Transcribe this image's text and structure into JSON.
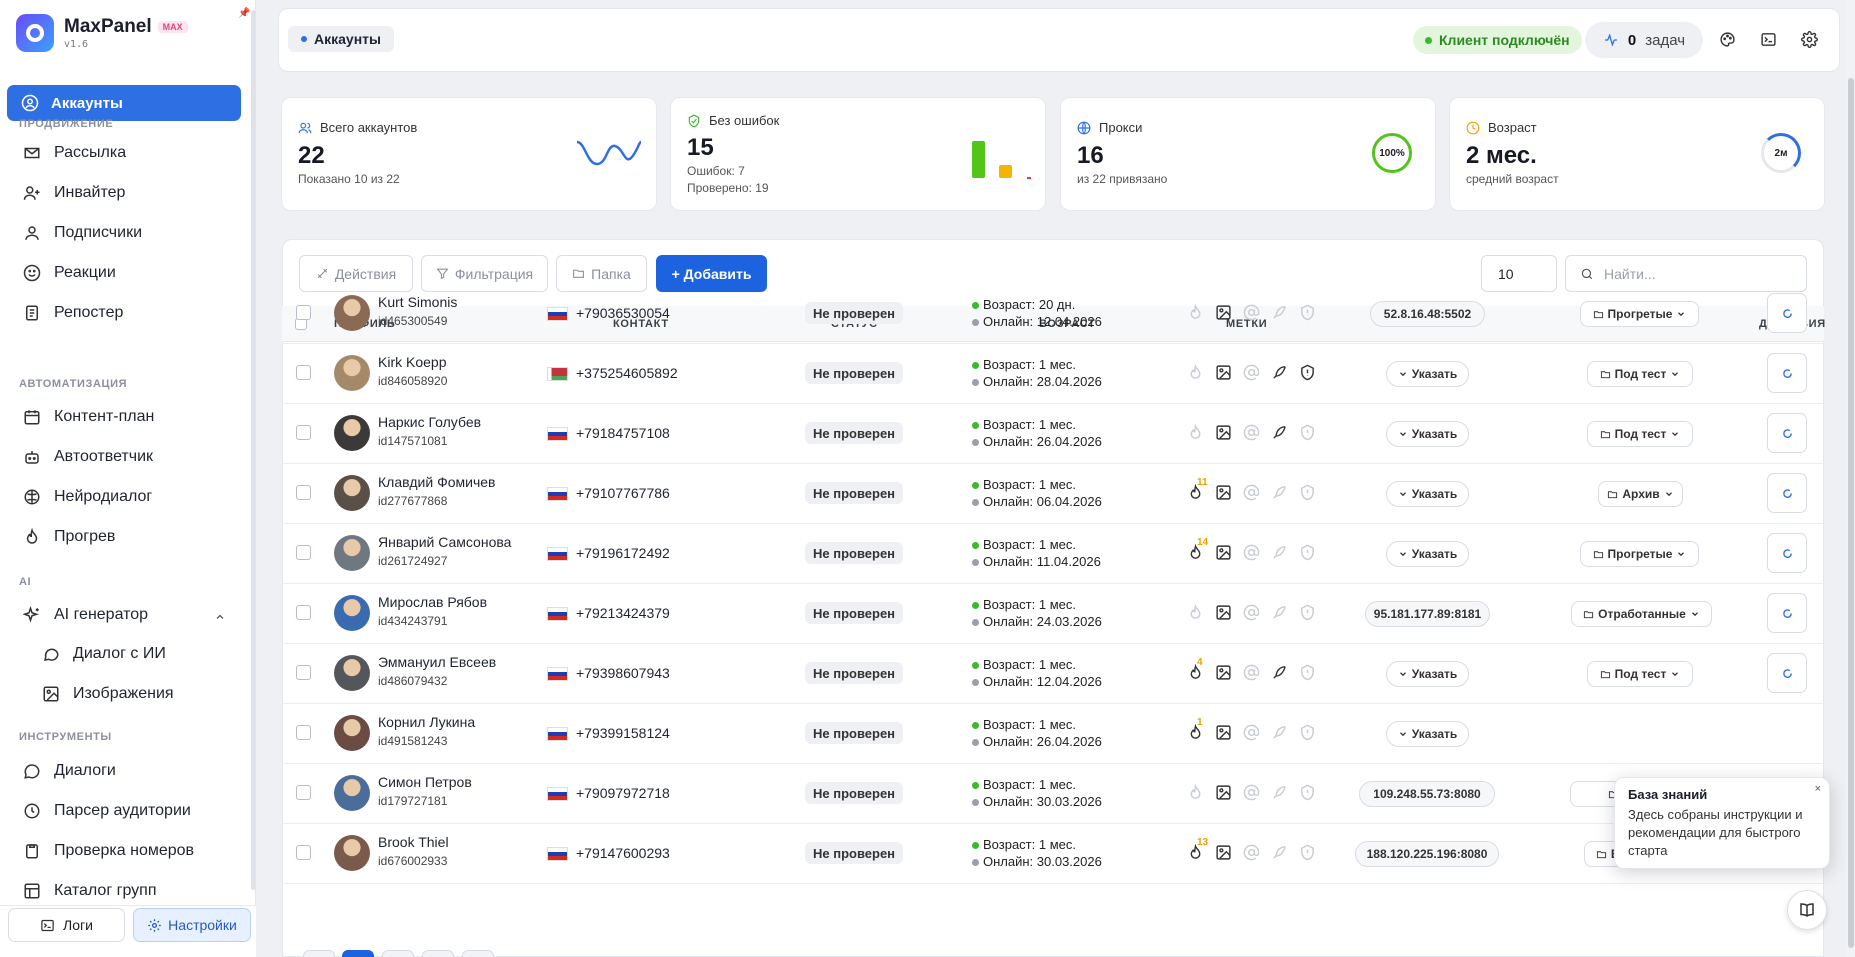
{
  "app": {
    "name": "MaxPanel",
    "badge": "MAX",
    "version": "v1.6"
  },
  "sidebar": {
    "active": "Аккаунты",
    "sections": {
      "promo": "ПРОДВИЖЕНИЕ",
      "auto": "АВТОМАТИЗАЦИЯ",
      "ai": "AI",
      "tools": "ИНСТРУМЕНТЫ"
    },
    "items": {
      "mailing": "Рассылка",
      "inviter": "Инвайтер",
      "subscribers": "Подписчики",
      "reactions": "Реакции",
      "reposter": "Репостер",
      "content_plan": "Контент-план",
      "autoresponder": "Автоответчик",
      "neurodialog": "Нейродиалог",
      "warmup": "Прогрев",
      "ai_generator": "AI генератор",
      "ai_dialog": "Диалог с ИИ",
      "ai_images": "Изображения",
      "dialogs": "Диалоги",
      "audience_parser": "Парсер аудитории",
      "number_check": "Проверка номеров",
      "group_catalog": "Каталог групп"
    },
    "footer": {
      "logs": "Логи",
      "settings": "Настройки"
    }
  },
  "header": {
    "crumb": "Аккаунты",
    "status": "Клиент подключён",
    "tasks_count": "0",
    "tasks_label": "задач"
  },
  "stats": {
    "total": {
      "label": "Всего аккаунтов",
      "value": "22",
      "sub": "Показано 10 из 22"
    },
    "no_errors": {
      "label": "Без ошибок",
      "value": "15",
      "sub1": "Ошибок: 7",
      "sub2": "Проверено: 19"
    },
    "proxy": {
      "label": "Прокси",
      "value": "16",
      "sub": "из 22 привязано",
      "ring": "100%",
      "ring_fraction": 1.0
    },
    "age": {
      "label": "Возраст",
      "value": "2 мес.",
      "sub": "средний возраст",
      "ring": "2м"
    }
  },
  "toolbar": {
    "actions": "Действия",
    "filter": "Фильтрация",
    "folder": "Папка",
    "add": "+ Добавить",
    "per_page": "10",
    "search_placeholder": "Найти..."
  },
  "columns": {
    "profile": "ПРОФИЛЬ",
    "contact": "КОНТАКТ",
    "status": "СТАТУС",
    "age": "ВОЗРАСТ",
    "tags": "МЕТКИ",
    "proxy": "ПРОКСИ",
    "folder": "ПАПКА",
    "actions": "ДЕЙСТВИЯ"
  },
  "rows": [
    {
      "name": "Kurt Simonis",
      "id": "id465300549",
      "flag": "ru",
      "phone": "+79036530054",
      "status": "Не проверен",
      "age": "Возраст: 20 дн.",
      "online": "Онлайн: 12.04.2026",
      "fire": "",
      "proxy": "52.8.16.48:5502",
      "folder": "Прогретые"
    },
    {
      "name": "Kirk Koepp",
      "id": "id846058920",
      "flag": "by",
      "phone": "+375254605892",
      "status": "Не проверен",
      "age": "Возраст: 1 мес.",
      "online": "Онлайн: 28.04.2026",
      "fire": "",
      "proxy": "",
      "folder": "Под тест"
    },
    {
      "name": "Наркис Голубев",
      "id": "id147571081",
      "flag": "ru",
      "phone": "+79184757108",
      "status": "Не проверен",
      "age": "Возраст: 1 мес.",
      "online": "Онлайн: 26.04.2026",
      "fire": "",
      "proxy": "",
      "folder": "Под тест"
    },
    {
      "name": "Клавдий Фомичев",
      "id": "id277677868",
      "flag": "ru",
      "phone": "+79107767786",
      "status": "Не проверен",
      "age": "Возраст: 1 мес.",
      "online": "Онлайн: 06.04.2026",
      "fire": "11",
      "proxy": "",
      "folder": "Архив"
    },
    {
      "name": "Январий Самсонова",
      "id": "id261724927",
      "flag": "ru",
      "phone": "+79196172492",
      "status": "Не проверен",
      "age": "Возраст: 1 мес.",
      "online": "Онлайн: 11.04.2026",
      "fire": "14",
      "proxy": "",
      "folder": "Прогретые"
    },
    {
      "name": "Мирослав Рябов",
      "id": "id434243791",
      "flag": "ru",
      "phone": "+79213424379",
      "status": "Не проверен",
      "age": "Возраст: 1 мес.",
      "online": "Онлайн: 24.03.2026",
      "fire": "",
      "proxy": "95.181.177.89:8181",
      "folder": "Отработанные"
    },
    {
      "name": "Эммануил Евсеев",
      "id": "id486079432",
      "flag": "ru",
      "phone": "+79398607943",
      "status": "Не проверен",
      "age": "Возраст: 1 мес.",
      "online": "Онлайн: 12.04.2026",
      "fire": "4",
      "proxy": "",
      "folder": "Под тест"
    },
    {
      "name": "Корнил Лукина",
      "id": "id491581243",
      "flag": "ru",
      "phone": "+79399158124",
      "status": "Не проверен",
      "age": "Возраст: 1 мес.",
      "online": "Онлайн: 26.04.2026",
      "fire": "1",
      "proxy": "",
      "folder": ""
    },
    {
      "name": "Симон Петров",
      "id": "id179727181",
      "flag": "ru",
      "phone": "+79097972718",
      "status": "Не проверен",
      "age": "Возраст: 1 мес.",
      "online": "Онлайн: 30.03.2026",
      "fire": "",
      "proxy": "109.248.55.73:8080",
      "folder": "От"
    },
    {
      "name": "Brook Thiel",
      "id": "id676002933",
      "flag": "ru",
      "phone": "+79147600293",
      "status": "Не проверен",
      "age": "Возраст: 1 мес.",
      "online": "Онлайн: 30.03.2026",
      "fire": "13",
      "proxy": "188.120.225.196:8080",
      "folder": "Без папки"
    }
  ],
  "specify_label": "Указать",
  "tooltip": {
    "title": "База знаний",
    "text": "Здесь собраны инструкции и рекомендации для быстрого старта",
    "close": "×"
  },
  "colors": {
    "accent": "#2f6fe4",
    "success": "#3cb82f",
    "warning": "#f0a000"
  }
}
